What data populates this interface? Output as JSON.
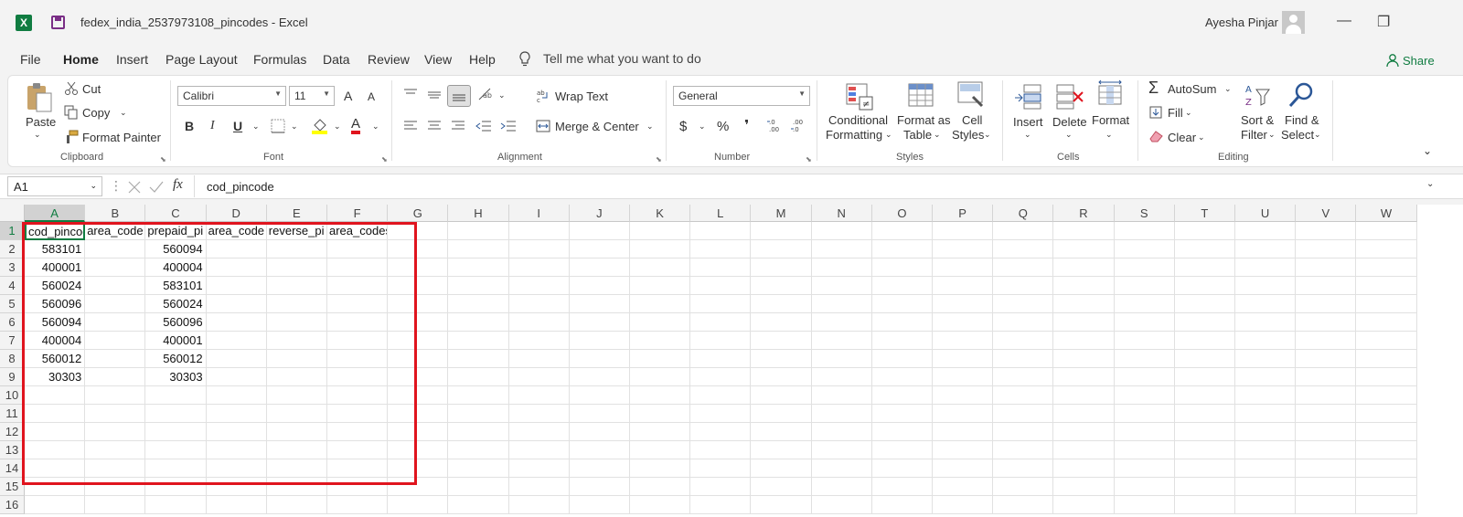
{
  "titlebar": {
    "doc_title": "fedex_india_2537973108_pincodes  -  Excel",
    "user_name": "Ayesha Pinjar",
    "minimize_glyph": "—",
    "restore_glyph": "❐",
    "logo_letter": "X"
  },
  "menu": {
    "items": [
      "File",
      "Home",
      "Insert",
      "Page Layout",
      "Formulas",
      "Data",
      "Review",
      "View",
      "Help"
    ],
    "tell_me": "Tell me what you want to do",
    "share": "Share"
  },
  "ribbon": {
    "clipboard": {
      "paste": "Paste",
      "cut": "Cut",
      "copy": "Copy",
      "format_painter": "Format Painter",
      "label": "Clipboard"
    },
    "font": {
      "name": "Calibri",
      "size": "11",
      "bold": "B",
      "italic": "I",
      "underline": "U",
      "grow": "A",
      "shrink": "A",
      "font_color": "A",
      "label": "Font"
    },
    "alignment": {
      "wrap_text": "Wrap Text",
      "merge_center": "Merge & Center",
      "label": "Alignment"
    },
    "number": {
      "format": "General",
      "currency": "$",
      "percent": "%",
      "comma": "❜",
      "label": "Number"
    },
    "styles": {
      "conditional": "Conditional",
      "conditional2": "Formatting",
      "format_as": "Format as",
      "format_as2": "Table",
      "cell": "Cell",
      "cell2": "Styles",
      "label": "Styles"
    },
    "cells": {
      "insert": "Insert",
      "delete": "Delete",
      "format": "Format",
      "label": "Cells"
    },
    "editing": {
      "autosum": "AutoSum",
      "fill": "Fill",
      "clear": "Clear",
      "sort": "Sort &",
      "sort2": "Filter",
      "find": "Find &",
      "find2": "Select",
      "label": "Editing"
    }
  },
  "formula_bar": {
    "name_box": "A1",
    "fx": "fx",
    "content": "cod_pincode"
  },
  "sheet": {
    "columns": [
      "A",
      "B",
      "C",
      "D",
      "E",
      "F",
      "G",
      "H",
      "I",
      "J",
      "K",
      "L",
      "M",
      "N",
      "O",
      "P",
      "Q",
      "R",
      "S",
      "T",
      "U",
      "V",
      "W"
    ],
    "rows": [
      "1",
      "2",
      "3",
      "4",
      "5",
      "6",
      "7",
      "8",
      "9",
      "10",
      "11",
      "12",
      "13",
      "14",
      "15",
      "16"
    ],
    "headers": [
      "cod_pincode",
      "area_code",
      "prepaid_pi",
      "area_code",
      "reverse_pi",
      "area_codes"
    ],
    "col_a": [
      "583101",
      "400001",
      "560024",
      "560096",
      "560094",
      "400004",
      "560012",
      "30303"
    ],
    "col_c": [
      "560094",
      "400004",
      "583101",
      "560024",
      "560096",
      "400001",
      "560012",
      "30303"
    ]
  },
  "colors": {
    "excel_green": "#107c41",
    "highlight_red": "#e0141e"
  }
}
